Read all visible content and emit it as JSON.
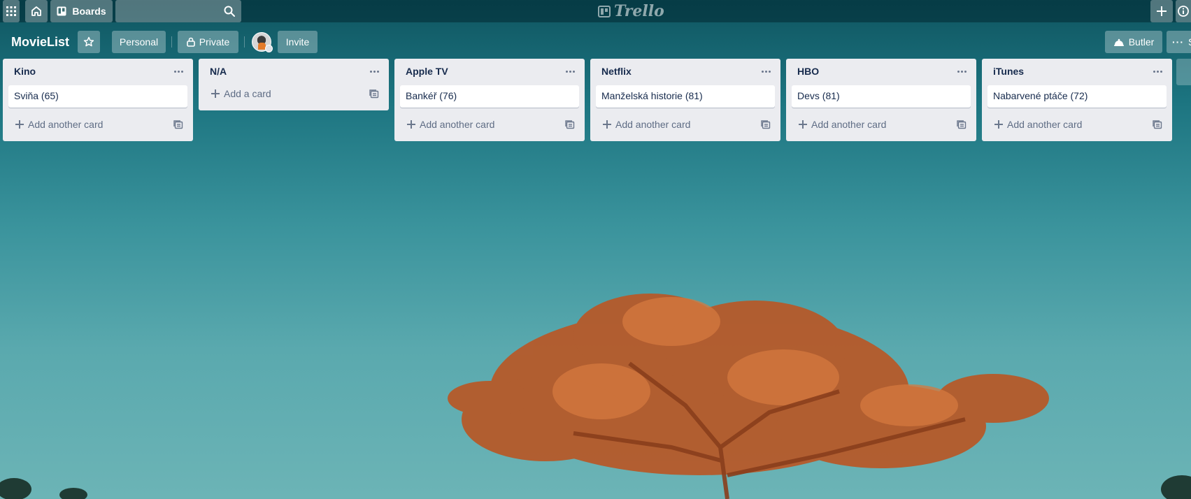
{
  "topbar": {
    "boards_label": "Boards",
    "logo_text": "Trello"
  },
  "board": {
    "title": "MovieList",
    "personal_label": "Personal",
    "private_label": "Private",
    "invite_label": "Invite",
    "butler_label": "Butler",
    "menu_label_partial": "S"
  },
  "lists": [
    {
      "title": "Kino",
      "cards": [
        "Sviňa (65)"
      ],
      "add_label": "Add another card"
    },
    {
      "title": "N/A",
      "cards": [],
      "add_label": "Add a card"
    },
    {
      "title": "Apple TV",
      "cards": [
        "Bankéř (76)"
      ],
      "add_label": "Add another card"
    },
    {
      "title": "Netflix",
      "cards": [
        "Manželská historie (81)"
      ],
      "add_label": "Add another card"
    },
    {
      "title": "HBO",
      "cards": [
        "Devs (81)"
      ],
      "add_label": "Add another card"
    },
    {
      "title": "iTunes",
      "cards": [
        "Nabarvené ptáče (72)"
      ],
      "add_label": "Add another card"
    }
  ],
  "colors": {
    "list_bg": "#ebecf0",
    "text": "#172b4d",
    "muted": "#5e6c84"
  }
}
